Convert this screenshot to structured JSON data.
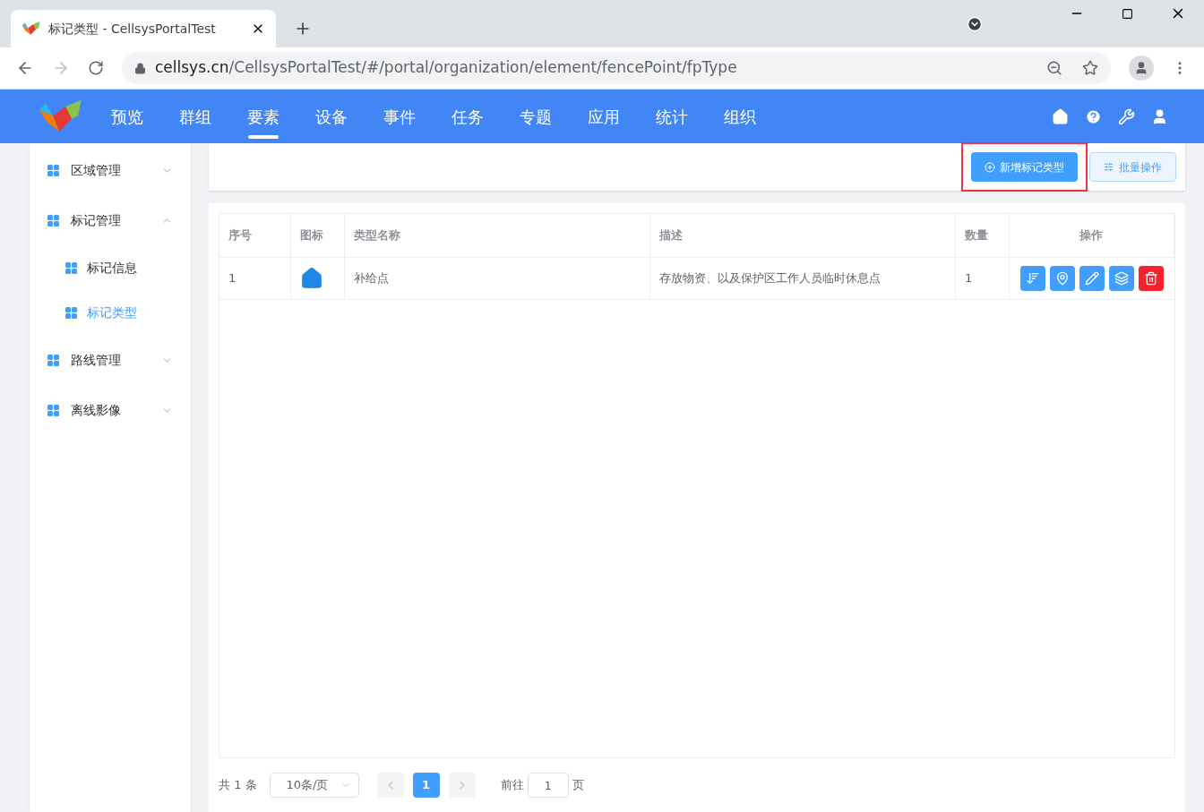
{
  "browser": {
    "tab_title": "标记类型 - CellsysPortalTest",
    "url_host": "cellsys.cn",
    "url_path": "/CellsysPortalTest/#/portal/organization/element/fencePoint/fpType"
  },
  "nav": [
    {
      "label": "预览",
      "selected": false
    },
    {
      "label": "群组",
      "selected": false
    },
    {
      "label": "要素",
      "selected": true
    },
    {
      "label": "设备",
      "selected": false
    },
    {
      "label": "事件",
      "selected": false
    },
    {
      "label": "任务",
      "selected": false
    },
    {
      "label": "专题",
      "selected": false
    },
    {
      "label": "应用",
      "selected": false
    },
    {
      "label": "统计",
      "selected": false
    },
    {
      "label": "组织",
      "selected": false
    }
  ],
  "sidebar": [
    {
      "label": "区域管理",
      "expanded": false,
      "selected": false
    },
    {
      "label": "标记管理",
      "expanded": true,
      "selected": false,
      "children": [
        {
          "label": "标记信息",
          "selected": false
        },
        {
          "label": "标记类型",
          "selected": true
        }
      ]
    },
    {
      "label": "路线管理",
      "expanded": false,
      "selected": false
    },
    {
      "label": "离线影像",
      "expanded": false,
      "selected": false
    }
  ],
  "toolbar": {
    "add_button": "新增标记类型",
    "add_highlighted": true,
    "batch_button": "批量操作"
  },
  "table": {
    "columns": [
      "序号",
      "图标",
      "类型名称",
      "描述",
      "数量",
      "操作"
    ],
    "rows": [
      {
        "index": "1",
        "name": "补给点",
        "description": "存放物资、以及保护区工作人员临时休息点",
        "count": "1"
      }
    ]
  },
  "pagination": {
    "total": "共 1 条",
    "page_size": "10条/页",
    "pages": [
      {
        "label": "1",
        "selected": true
      }
    ],
    "goto_label": "前往",
    "goto_value": "1",
    "goto_suffix": "页"
  }
}
